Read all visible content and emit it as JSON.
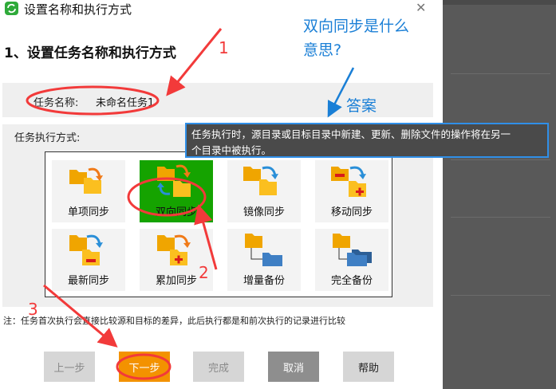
{
  "dialog": {
    "title": "设置名称和执行方式",
    "close_glyph": "✕",
    "heading": "1、设置任务名称和执行方式",
    "name_label": "任务名称:",
    "name_value": "未命名任务1",
    "mode_label": "任务执行方式:",
    "modes": [
      {
        "label": "单项同步",
        "icon": "single-sync-icon",
        "selected": false
      },
      {
        "label": "双向同步",
        "icon": "two-way-sync-icon",
        "selected": true
      },
      {
        "label": "镜像同步",
        "icon": "mirror-sync-icon",
        "selected": false
      },
      {
        "label": "移动同步",
        "icon": "move-sync-icon",
        "selected": false
      },
      {
        "label": "最新同步",
        "icon": "latest-sync-icon",
        "selected": false
      },
      {
        "label": "累加同步",
        "icon": "cumulative-sync-icon",
        "selected": false
      },
      {
        "label": "增量备份",
        "icon": "incremental-backup-icon",
        "selected": false
      },
      {
        "label": "完全备份",
        "icon": "full-backup-icon",
        "selected": false
      }
    ],
    "note": "注：任务首次执行会直接比较源和目标的差异，此后执行都是和前次执行的记录进行比较",
    "buttons": {
      "prev": "上一步",
      "next": "下一步",
      "done": "完成",
      "cancel": "取消",
      "help": "帮助"
    }
  },
  "tooltip": {
    "line1": "任务执行时，源目录或目标目录中新建、更新、删除文件的操作将在另一",
    "line2": "个目录中被执行。"
  },
  "annotations": {
    "question_line1": "双向同步是什么",
    "question_line2": "意思?",
    "answer": "答案",
    "step1": "1",
    "step2": "2",
    "step3": "3"
  },
  "colors": {
    "selected_tile": "#15a300",
    "next_button": "#f39200",
    "annotation_blue": "#1a7fd6",
    "annotation_red": "#f23a3a",
    "tooltip_border": "#2f8fe8"
  }
}
